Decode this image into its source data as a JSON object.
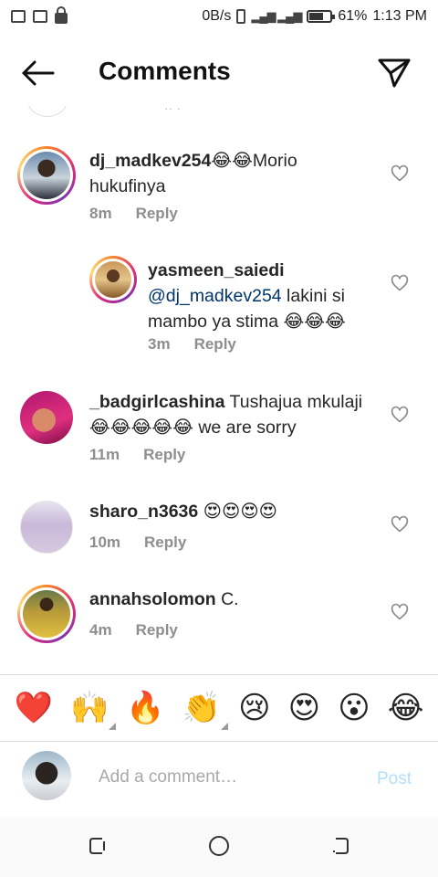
{
  "status_bar": {
    "network_speed": "0B/s",
    "battery_percent": "61%",
    "time": "1:13 PM"
  },
  "header": {
    "title": "Comments"
  },
  "comments": [
    {
      "username": "dj_madkev254",
      "text": "😂😂Morio hukufinya",
      "time": "8m",
      "reply_label": "Reply"
    },
    {
      "username": "yasmeen_saiedi",
      "mention": "@dj_madkev254",
      "text": " lakini si mambo ya stima 😂😂😂",
      "time": "3m",
      "reply_label": "Reply"
    },
    {
      "username": "_badgirlcashina",
      "text": " Tushajua mkulaji 😂😂😂😂😂 we are sorry",
      "time": "11m",
      "reply_label": "Reply"
    },
    {
      "username": "sharo_n3636",
      "text": " 😍😍😍😍",
      "time": "10m",
      "reply_label": "Reply"
    },
    {
      "username": "annahsolomon",
      "text": " C.",
      "time": "4m",
      "reply_label": "Reply"
    }
  ],
  "emoji_bar": [
    "❤️",
    "🙌",
    "🔥",
    "👏",
    "😢",
    "😍",
    "😮",
    "😂"
  ],
  "composer": {
    "placeholder": "Add a comment…",
    "post_label": "Post"
  },
  "colors": {
    "text": "#262626",
    "meta": "#8e8e8e",
    "mention": "#003569",
    "post_disabled": "#b2dffc",
    "heart": "#e0245e"
  }
}
